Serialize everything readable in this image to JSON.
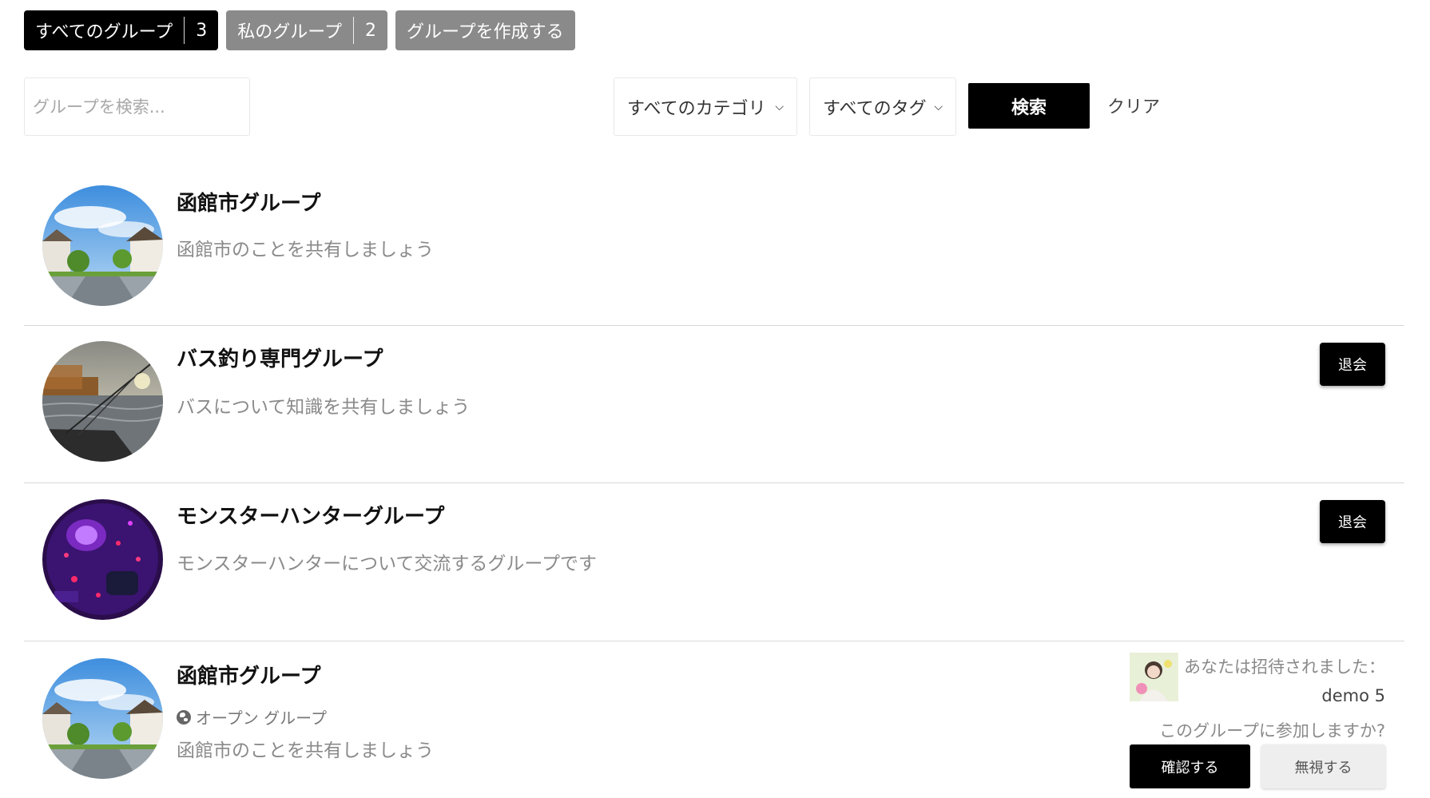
{
  "tabs": [
    {
      "label": "すべてのグループ",
      "count": "3",
      "active": true
    },
    {
      "label": "私のグループ",
      "count": "2",
      "active": false
    },
    {
      "label": "グループを作成する",
      "active": false
    }
  ],
  "search": {
    "placeholder": "グループを検索...",
    "category_label": "すべてのカテゴリ",
    "tag_label": "すべてのタグ",
    "search_button": "検索",
    "clear_button": "クリア"
  },
  "groups": [
    {
      "title": "函館市グループ",
      "description": "函館市のことを共有しましょう",
      "avatar": "town-street-photo"
    },
    {
      "title": "バス釣り専門グループ",
      "description": "バスについて知識を共有しましょう",
      "avatar": "fishing-boat-photo",
      "action": "退会"
    },
    {
      "title": "モンスターハンターグループ",
      "description": "モンスターハンターについて交流するグループです",
      "avatar": "gaming-neon-photo",
      "action": "退会"
    },
    {
      "title": "函館市グループ",
      "status": "オープン グループ",
      "description": "函館市のことを共有しましょう",
      "avatar": "town-street-photo",
      "invite": {
        "message": "あなたは招待されました：",
        "inviter": "demo 5",
        "question": "このグループに参加しますか?",
        "confirm": "確認する",
        "ignore": "無視する"
      }
    }
  ],
  "colors": {
    "primary": "#000000",
    "inactive_tab": "#8a8a8a",
    "muted_text": "#8a8a8a",
    "divider": "#d9d9d9"
  }
}
